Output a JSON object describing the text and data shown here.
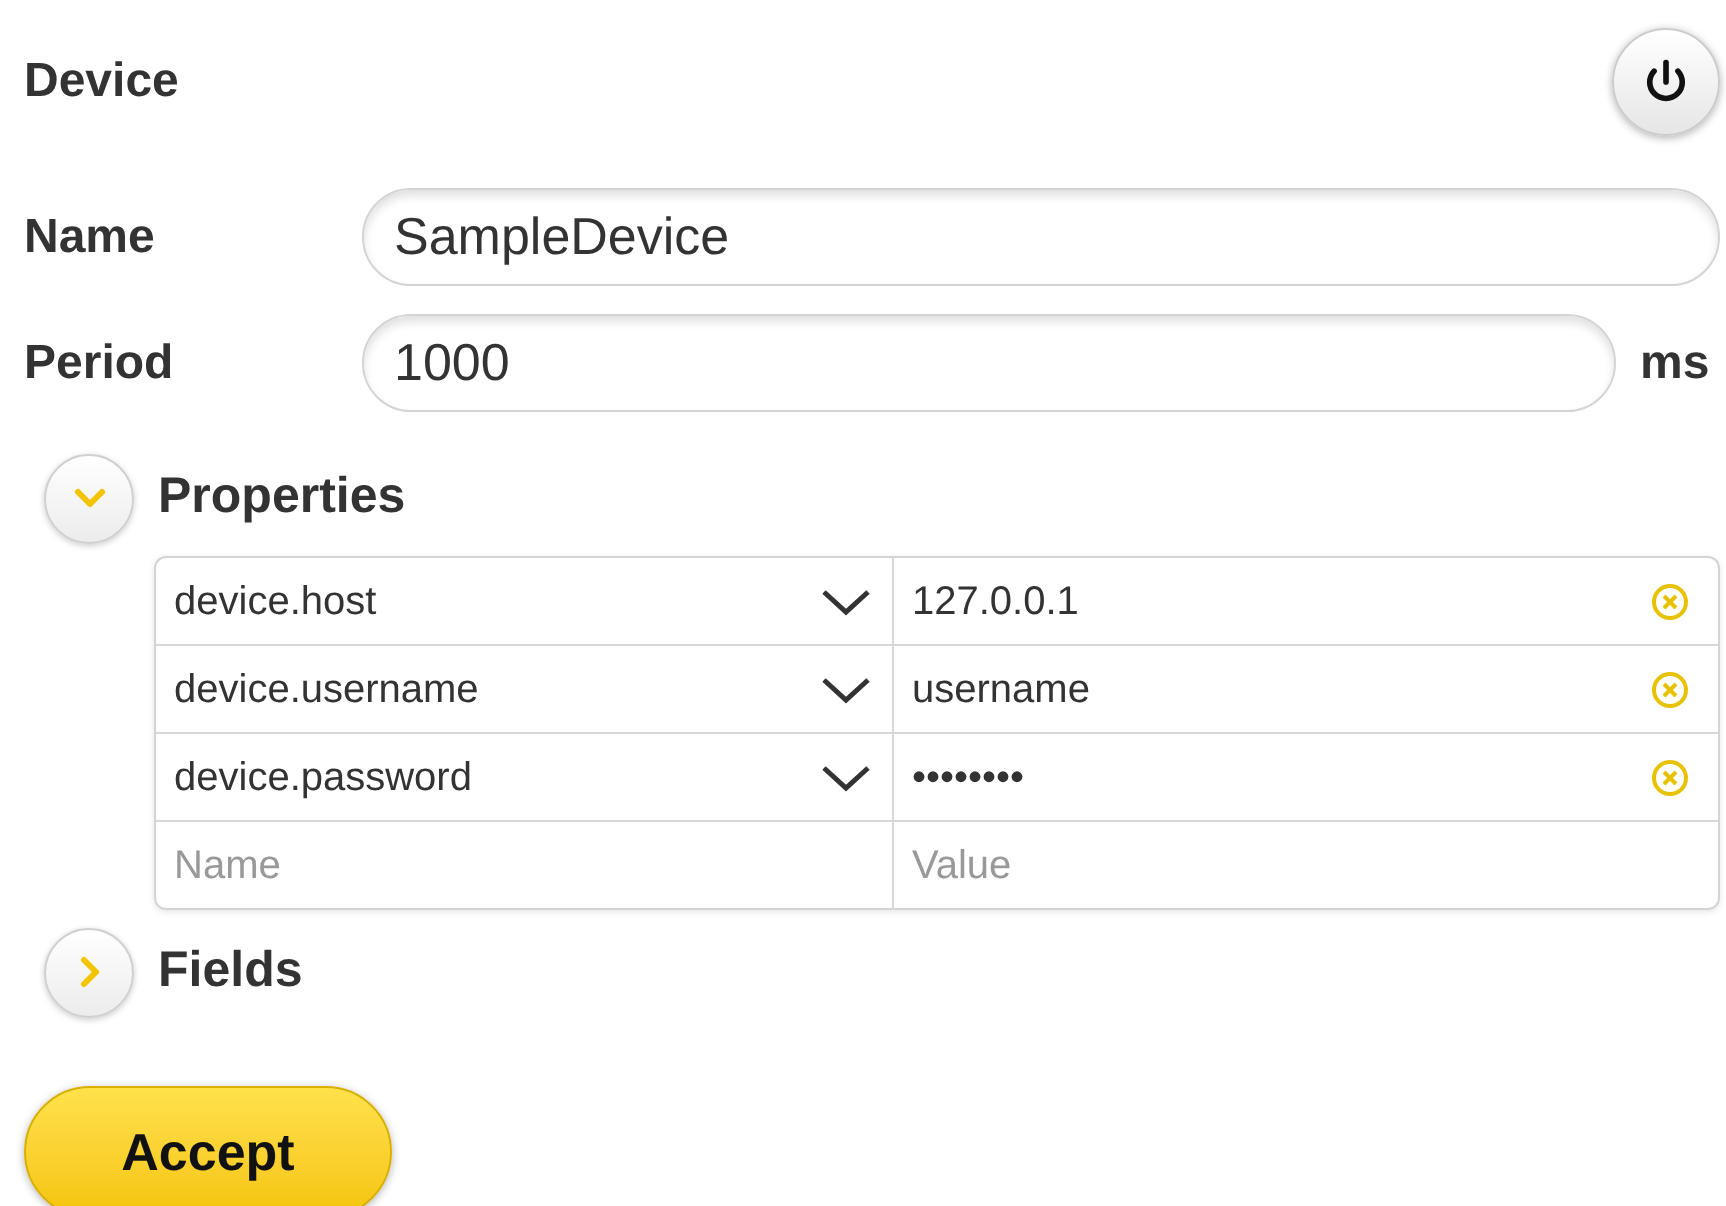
{
  "title": "Device",
  "fields": [
    {
      "label": "Name",
      "value": "SampleDevice"
    },
    {
      "label": "Period",
      "value": "1000",
      "unit": "ms"
    }
  ],
  "sections": [
    {
      "title": "Properties",
      "expanded": true,
      "rows": [
        {
          "name": "device.host",
          "value": "127.0.0.1"
        },
        {
          "name": "device.username",
          "value": "username"
        },
        {
          "name": "device.password",
          "value": "••••••••"
        }
      ],
      "new_row": {
        "name_placeholder": "Name",
        "value_placeholder": "Value"
      }
    },
    {
      "title": "Fields",
      "expanded": false
    }
  ],
  "accept_button": "Accept"
}
